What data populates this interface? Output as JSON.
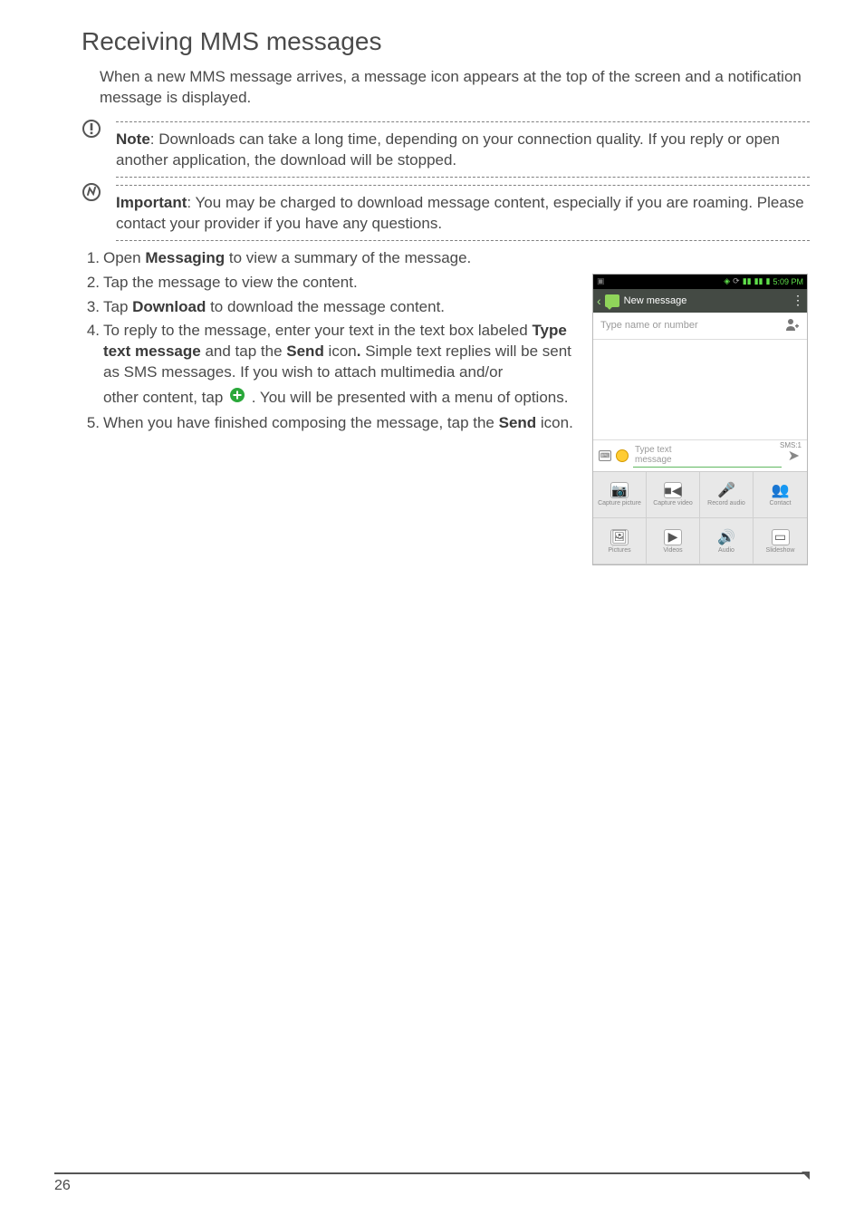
{
  "title": "Receiving MMS messages",
  "intro": "When a new MMS message arrives, a message icon appears at the top of the screen and a notification message is displayed.",
  "note": {
    "label": "Note",
    "text": ": Downloads can take a long time, depending on your connection quality. If you reply or open another application, the download will be stopped."
  },
  "important": {
    "label": "Important",
    "text": ": You may be charged to download message content, especially if you are roaming. Please contact your provider if you have any questions."
  },
  "steps": {
    "s1a": "Open ",
    "s1b": "Messaging",
    "s1c": " to view a summary of the message.",
    "s2": "Tap the message to view the content.",
    "s3a": "Tap ",
    "s3b": "Download",
    "s3c": " to download the message content.",
    "s4a": "To reply to the message, enter your text in the text box labeled ",
    "s4b": "Type text message",
    "s4c": " and tap the ",
    "s4d": "Send",
    "s4e": " icon",
    "s4f": ". ",
    "s4g": "Simple text replies will be sent as SMS messages. If you wish to attach multimedia and/or",
    "s4sub_a": "other content, tap ",
    "s4sub_b": " . You will be presented with a menu of options.",
    "s5a": "When you have finished composing the message, tap the ",
    "s5b": "Send",
    "s5c": " icon."
  },
  "phone": {
    "time": "5:09 PM",
    "title": "New message",
    "recipient_placeholder": "Type name or number",
    "type_hint_line1": "Type text",
    "type_hint_line2": "message",
    "sms_count": "SMS:1",
    "attach": {
      "a1": "Capture picture",
      "a2": "Capture video",
      "a3": "Record audio",
      "a4": "Contact",
      "a5": "Pictures",
      "a6": "Videos",
      "a7": "Audio",
      "a8": "Slideshow"
    }
  },
  "page_number": "26"
}
